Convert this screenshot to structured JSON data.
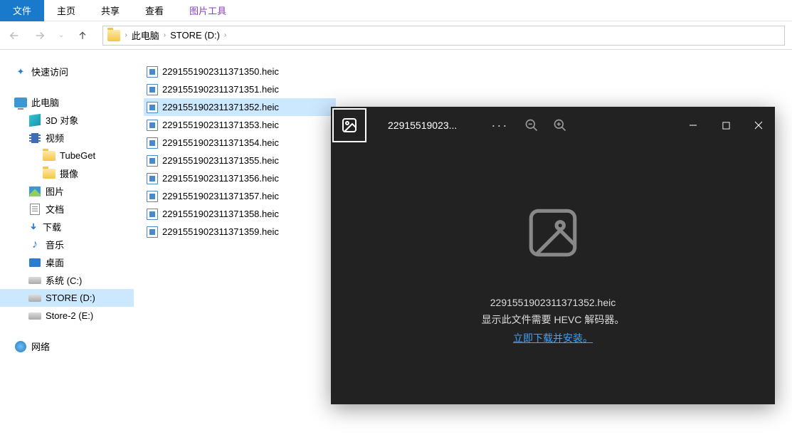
{
  "ribbon": {
    "file": "文件",
    "home": "主页",
    "share": "共享",
    "view": "查看",
    "picture_tools": "图片工具"
  },
  "breadcrumb": {
    "this_pc": "此电脑",
    "drive": "STORE (D:)"
  },
  "sidebar": {
    "quick_access": "快速访问",
    "this_pc": "此电脑",
    "objects_3d": "3D 对象",
    "videos": "视频",
    "tubeget": "TubeGet",
    "camera": "摄像",
    "pictures": "图片",
    "documents": "文档",
    "downloads": "下载",
    "music": "音乐",
    "desktop": "桌面",
    "drive_c": "系统 (C:)",
    "drive_d": "STORE (D:)",
    "drive_e": "Store-2 (E:)",
    "network": "网络"
  },
  "files": [
    "2291551902311371350.heic",
    "2291551902311371351.heic",
    "2291551902311371352.heic",
    "2291551902311371353.heic",
    "2291551902311371354.heic",
    "2291551902311371355.heic",
    "2291551902311371356.heic",
    "2291551902311371357.heic",
    "2291551902311371358.heic",
    "2291551902311371359.heic"
  ],
  "selected_file_index": 2,
  "photos": {
    "title_truncated": "22915519023...",
    "more": "···",
    "filename": "2291551902311371352.heic",
    "message": "显示此文件需要 HEVC 解码器。",
    "link": "立即下载并安装。"
  }
}
